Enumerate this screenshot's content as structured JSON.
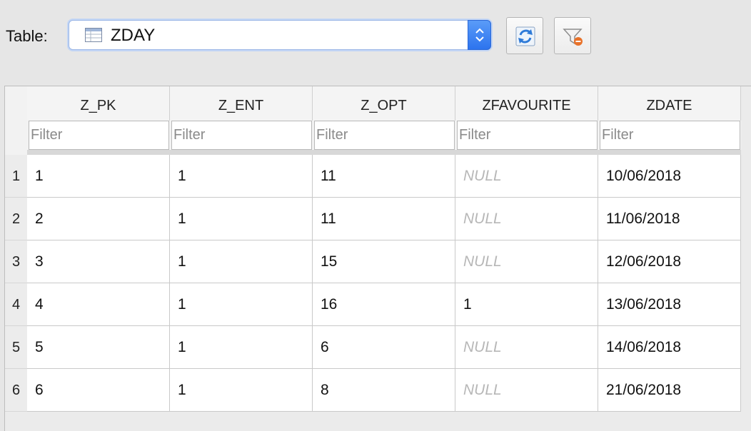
{
  "toolbar": {
    "table_label": "Table:",
    "selected_table": "ZDAY",
    "table_icon": "table-grid-icon",
    "refresh_icon": "refresh-icon",
    "clear_filters_icon": "clear-filter-icon"
  },
  "grid": {
    "columns": [
      "Z_PK",
      "Z_ENT",
      "Z_OPT",
      "ZFAVOURITE",
      "ZDATE"
    ],
    "filter_placeholder": "Filter",
    "row_numbers": [
      "1",
      "2",
      "3",
      "4",
      "5",
      "6"
    ],
    "rows": [
      [
        "1",
        "1",
        "11",
        "NULL",
        "10/06/2018"
      ],
      [
        "2",
        "1",
        "11",
        "NULL",
        "11/06/2018"
      ],
      [
        "3",
        "1",
        "15",
        "NULL",
        "12/06/2018"
      ],
      [
        "4",
        "1",
        "16",
        "1",
        "13/06/2018"
      ],
      [
        "5",
        "1",
        "6",
        "NULL",
        "14/06/2018"
      ],
      [
        "6",
        "1",
        "8",
        "NULL",
        "21/06/2018"
      ]
    ]
  },
  "colors": {
    "accent": "#2d74ee",
    "null_text": "#b7b7b7"
  }
}
